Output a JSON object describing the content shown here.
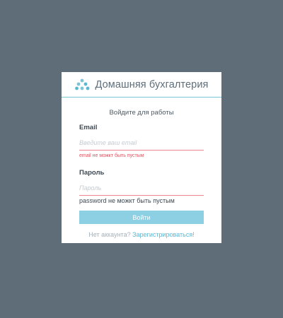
{
  "app": {
    "title": "Домашняя бухгалтерия"
  },
  "login_form": {
    "subtitle": "Войдите для работы",
    "email": {
      "label": "Email",
      "value": "",
      "placeholder": "Введите ваш email",
      "error": "email не можкт быть пустым"
    },
    "password": {
      "label": "Пароль",
      "value": "",
      "placeholder": "Пароль",
      "error": "password не можкт быть пустым"
    },
    "submit_label": "Войти",
    "register_prompt": "Нет аккаунта?",
    "register_link": "Зарегистрироваться!"
  },
  "icons": {
    "logo": "dots-logo-icon"
  },
  "colors": {
    "background": "#5f6d79",
    "accent": "#5ab8d3",
    "button": "#8ed0e3",
    "error": "#e0545f"
  }
}
